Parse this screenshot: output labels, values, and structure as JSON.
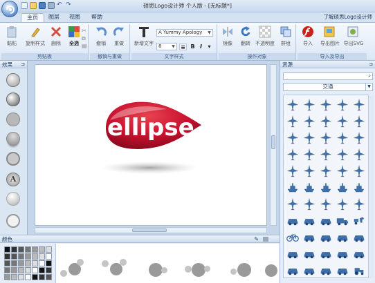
{
  "window": {
    "title": "硕思Logo设计师 个人版 - [无标题*]"
  },
  "tabs": [
    {
      "label": "主页"
    },
    {
      "label": "图层"
    },
    {
      "label": "视图"
    },
    {
      "label": "帮助"
    }
  ],
  "help_link": "了解硕思Logo设计师",
  "ribbon": {
    "clipboard": {
      "label": "剪贴板",
      "paste": "黏贴",
      "copy_style": "复制样式",
      "delete": "删除",
      "select_all": "全选"
    },
    "undo": {
      "label": "撤销与重做",
      "undo": "撤销",
      "redo": "重做"
    },
    "text": {
      "label": "文字样式",
      "new_text": "新增文字",
      "font": "A Yummy Apology",
      "size": "8",
      "bold": "B",
      "italic": "I"
    },
    "ops": {
      "label": "操作对象",
      "mirror": "镜像",
      "rotate": "翻转",
      "opacity": "不透明度",
      "group": "群组"
    },
    "io": {
      "label": "导入及导出",
      "import": "导入",
      "export_image": "导出图片",
      "export_svg": "导出SVG"
    }
  },
  "effects_panel": {
    "title": "效果",
    "pin": "⊐"
  },
  "resources_panel": {
    "title": "资源",
    "pin": "⊐",
    "search_placeholder": "",
    "category": "交通"
  },
  "color_panel": {
    "title": "颜色"
  },
  "canvas": {
    "logo_text": "ellipse",
    "logo_color": "#c8102e"
  },
  "icons": [
    "airplane-icon",
    "airplane-icon",
    "airplane-icon",
    "airplane-icon",
    "airplane-icon",
    "airplane-icon",
    "airplane-icon",
    "airplane-icon",
    "airplane-icon",
    "airplane-icon",
    "airplane-icon",
    "airplane-icon",
    "airplane-icon",
    "airplane-icon",
    "airplane-icon",
    "airplane-icon",
    "airplane-icon",
    "airplane-icon",
    "airplane-icon",
    "airplane-icon",
    "airplane-icon",
    "airplane-icon",
    "airplane-icon",
    "airplane-icon",
    "airplane-icon",
    "ship-icon",
    "ship-icon",
    "ship-icon",
    "ship-icon",
    "ship-icon",
    "airplane-icon",
    "airplane-icon",
    "airplane-icon",
    "airplane-icon",
    "airplane-icon",
    "car-icon",
    "car-icon",
    "car-icon",
    "truck-icon",
    "horse-cart-icon",
    "bicycle-icon",
    "car-icon",
    "car-icon",
    "car-icon",
    "car-icon",
    "car-icon",
    "car-icon",
    "car-icon",
    "car-icon",
    "car-icon",
    "car-icon",
    "car-icon",
    "car-icon",
    "car-icon",
    "tractor-icon"
  ]
}
